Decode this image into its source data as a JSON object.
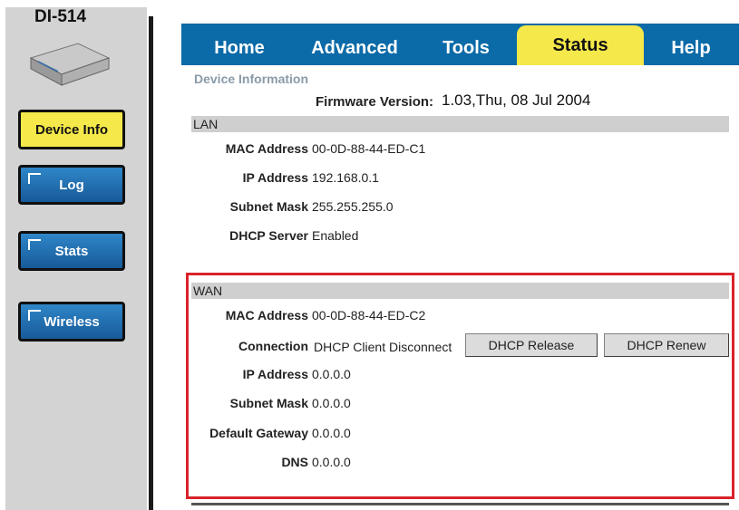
{
  "sidebar": {
    "model": "DI-514",
    "items": [
      {
        "label": "Device Info",
        "active": true
      },
      {
        "label": "Log"
      },
      {
        "label": "Stats"
      },
      {
        "label": "Wireless"
      }
    ]
  },
  "tabs": [
    {
      "label": "Home"
    },
    {
      "label": "Advanced"
    },
    {
      "label": "Tools"
    },
    {
      "label": "Status",
      "active": true
    },
    {
      "label": "Help"
    }
  ],
  "device_info": {
    "subtitle": "Device Information",
    "firmware_label": "Firmware Version:",
    "firmware_value": "1.03,Thu, 08 Jul 2004"
  },
  "lan": {
    "title": "LAN",
    "rows": [
      {
        "label": "MAC Address",
        "value": "00-0D-88-44-ED-C1"
      },
      {
        "label": "IP Address",
        "value": "192.168.0.1"
      },
      {
        "label": "Subnet Mask",
        "value": "255.255.255.0"
      },
      {
        "label": "DHCP Server",
        "value": "Enabled"
      }
    ]
  },
  "wan": {
    "title": "WAN",
    "mac": {
      "label": "MAC Address",
      "value": "00-0D-88-44-ED-C2"
    },
    "connection": {
      "label": "Connection",
      "value": "DHCP Client Disconnect"
    },
    "release_button": "DHCP Release",
    "renew_button": "DHCP Renew",
    "rows": [
      {
        "label": "IP Address",
        "value": "0.0.0.0"
      },
      {
        "label": "Subnet Mask",
        "value": "0.0.0.0"
      },
      {
        "label": "Default Gateway",
        "value": "0.0.0.0"
      },
      {
        "label": "DNS",
        "value": "0.0.0.0"
      }
    ]
  },
  "colors": {
    "tab_blue": "#0b6aa8",
    "active_yellow": "#f5e84a",
    "highlight_red": "#d9232a"
  }
}
